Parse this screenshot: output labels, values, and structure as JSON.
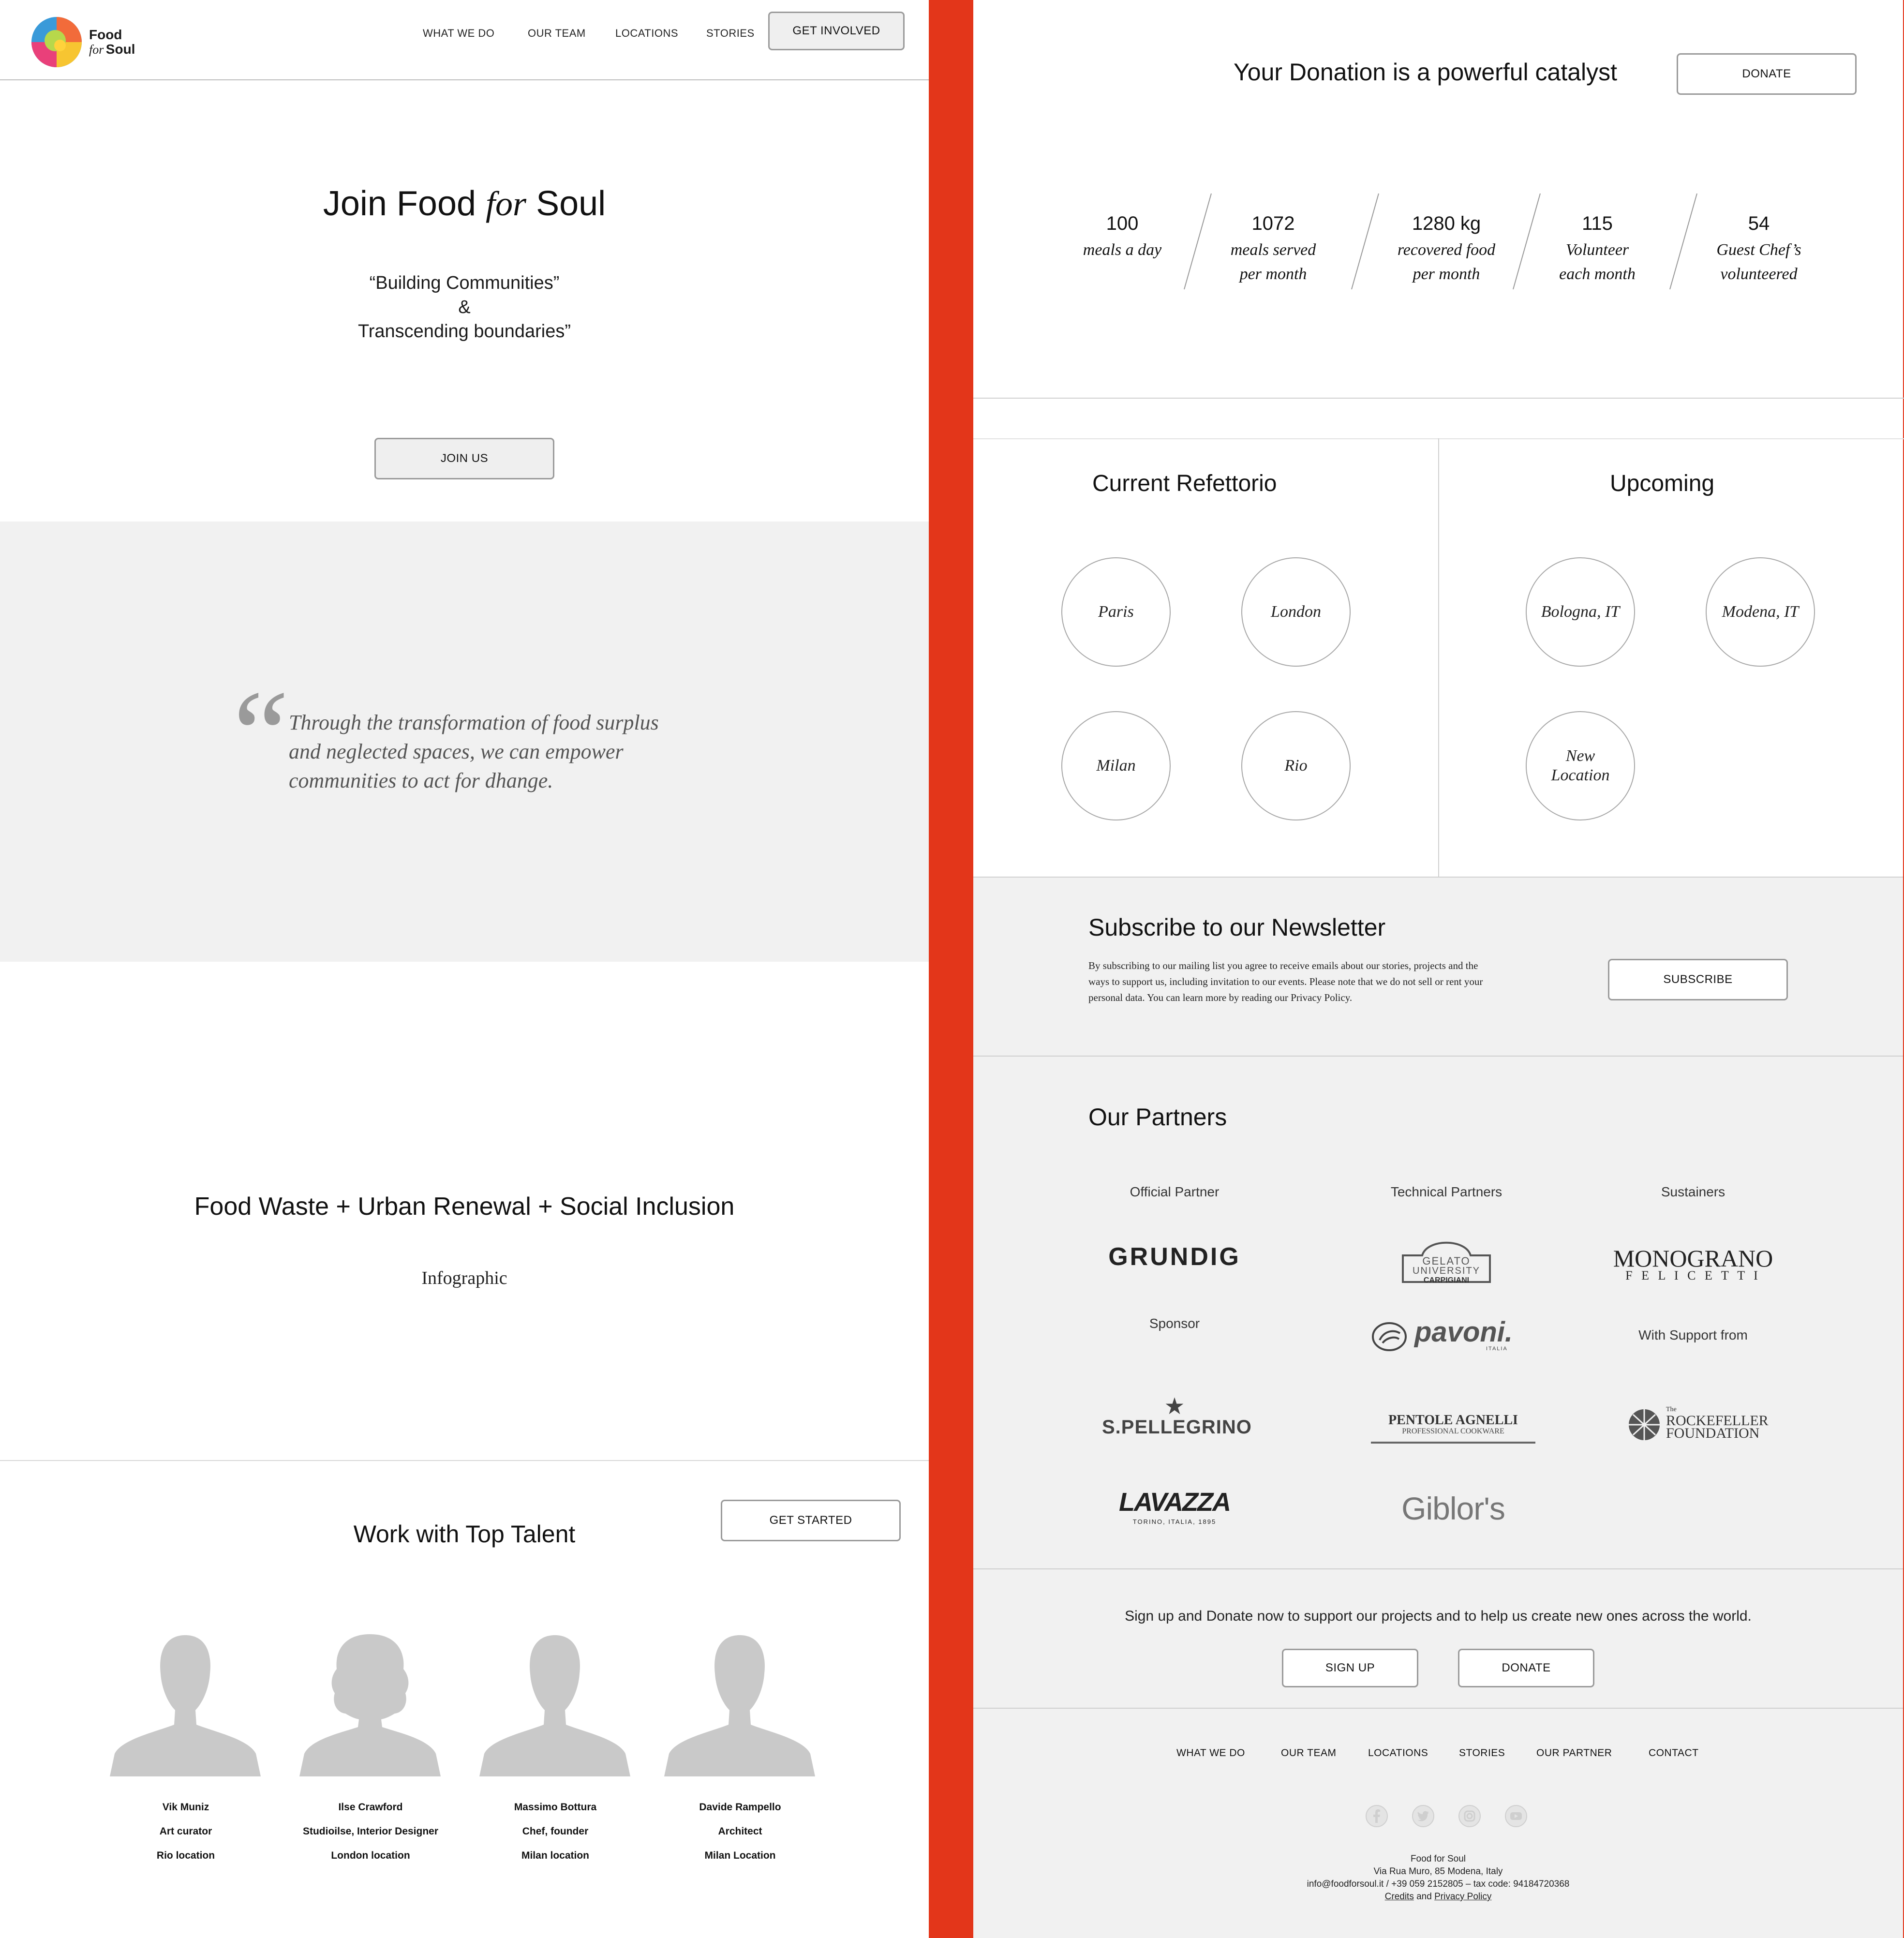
{
  "colors": {
    "accent_strip": "#e3361a",
    "grey_section": "#f1f1f1",
    "avatar": "#c9c9c9",
    "border": "#a8a8a8"
  },
  "header": {
    "logo_line1": "Food",
    "logo_for": "for",
    "logo_line2": "Soul",
    "nav": [
      "WHAT WE DO",
      "OUR TEAM",
      "LOCATIONS",
      "STORIES"
    ],
    "cta": "GET INVOLVED"
  },
  "hero": {
    "title_a": "Join Food ",
    "title_for": "for",
    "title_b": " Soul",
    "tagline_1": "“Building Communities”",
    "tagline_2": "&",
    "tagline_3": "Transcending boundaries”",
    "button": "JOIN US"
  },
  "quote": {
    "mark": "“",
    "line_1": "Through the transformation of food surplus",
    "line_2": "and neglected spaces, we can empower",
    "line_3": "communities to act for dhange."
  },
  "mission": {
    "title": "Food Waste + Urban Renewal + Social Inclusion",
    "subtitle": "Infographic"
  },
  "talent": {
    "title": "Work with Top Talent",
    "button": "GET STARTED",
    "people": [
      {
        "name": "Vik Muniz",
        "role": "Art curator",
        "location": "Rio location"
      },
      {
        "name": "Ilse Crawford",
        "role": "Studioilse, Interior Designer",
        "location": "London location"
      },
      {
        "name": "Massimo Bottura",
        "role": "Chef, founder",
        "location": "Milan location"
      },
      {
        "name": "Davide Rampello",
        "role": "Architect",
        "location": "Milan Location"
      }
    ]
  },
  "donation": {
    "title": "Your Donation is a powerful catalyst",
    "button": "DONATE",
    "stats": [
      {
        "value": "100",
        "label_1": "meals a day",
        "label_2": ""
      },
      {
        "value": "1072",
        "label_1": "meals served",
        "label_2": "per month"
      },
      {
        "value": "1280 kg",
        "label_1": "recovered food",
        "label_2": "per month"
      },
      {
        "value": "115",
        "label_1": "Volunteer",
        "label_2": "each month"
      },
      {
        "value": "54",
        "label_1": "Guest Chef’s",
        "label_2": "volunteered"
      }
    ]
  },
  "locations": {
    "current_title": "Current Refettorio",
    "current": [
      "Paris",
      "London",
      "Milan",
      "Rio"
    ],
    "upcoming_title": "Upcoming",
    "upcoming": [
      "Bologna, IT",
      "Modena, IT"
    ],
    "new_1": "New",
    "new_2": "Location"
  },
  "newsletter": {
    "title": "Subscribe to our Newsletter",
    "line_1": "By subscribing to our mailing list you agree to receive emails about our stories, projects and the",
    "line_2": "ways to support us, including invitation to our events. Please note that we do not sell or rent your",
    "line_3": "personal data. You can learn more by reading our Privacy Policy.",
    "button": "SUBSCRIBE"
  },
  "partners": {
    "title": "Our Partners",
    "official": "Official Partner",
    "technical": "Technical Partners",
    "sustainers": "Sustainers",
    "sponsor": "Sponsor",
    "support": "With Support from",
    "logos": {
      "grundig": "GRUNDIG",
      "gelato_1": "GELATO",
      "gelato_2": "UNIVERSITY",
      "gelato_3": "CARPIGIANI",
      "monograno_1": "MONOGRANO",
      "monograno_2": "F E L I C E T T I",
      "pavoni": "pavoni.",
      "pavoni_sub": "ITALIA",
      "pellegrino": "S.PELLEGRINO",
      "pentole_1": "PENTOLE AGNELLI",
      "pentole_2": "PROFESSIONAL COOKWARE",
      "rockefeller_1": "The",
      "rockefeller_2": "ROCKEFELLER",
      "rockefeller_3": "FOUNDATION",
      "lavazza": "LAVAZZA",
      "lavazza_sub": "TORINO, ITALIA, 1895",
      "giblors": "Giblor's"
    }
  },
  "cta": {
    "text": "Sign up and Donate now to support our projects and to help us create new ones across the world.",
    "signup": "SIGN UP",
    "donate": "DONATE"
  },
  "footer": {
    "nav": [
      "WHAT WE DO",
      "OUR TEAM",
      "LOCATIONS",
      "STORIES",
      "OUR PARTNER",
      "CONTACT"
    ],
    "social_icons": [
      "facebook-icon",
      "twitter-icon",
      "instagram-icon",
      "youtube-icon"
    ],
    "org": "Food for Soul",
    "address": "Via Rua Muro, 85 Modena, Italy",
    "contact": "info@foodforsoul.it / +39 059 2152805 – tax code: 94184720368",
    "credits": "Credits",
    "and": "and",
    "privacy": "Privacy Policy"
  }
}
